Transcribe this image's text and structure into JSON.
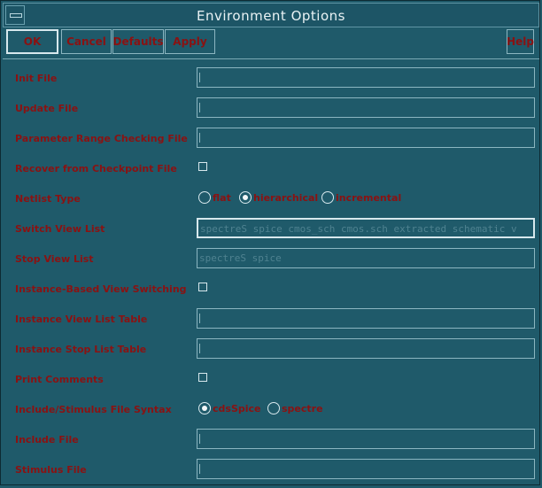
{
  "window": {
    "title": "Environment Options"
  },
  "toolbar": {
    "ok": "OK",
    "cancel": "Cancel",
    "defaults": "Defaults",
    "apply": "Apply",
    "help": "Help"
  },
  "form": {
    "init_file": {
      "label": "Init File",
      "value": ""
    },
    "update_file": {
      "label": "Update File",
      "value": ""
    },
    "parameter_range_checking_file": {
      "label": "Parameter Range Checking File",
      "value": ""
    },
    "recover_from_checkpoint_file": {
      "label": "Recover from Checkpoint File",
      "checked": false
    },
    "netlist_type": {
      "label": "Netlist Type",
      "options": [
        "flat",
        "hierarchical",
        "incremental"
      ],
      "selected": "hierarchical"
    },
    "switch_view_list": {
      "label": "Switch View List",
      "value": "spectreS spice cmos_sch cmos.sch extracted schematic v"
    },
    "stop_view_list": {
      "label": "Stop View List",
      "value": "spectreS spice"
    },
    "instance_based_view_switching": {
      "label": "Instance-Based View Switching",
      "checked": false
    },
    "instance_view_list_table": {
      "label": "Instance View List Table",
      "value": ""
    },
    "instance_stop_list_table": {
      "label": "Instance Stop List Table",
      "value": ""
    },
    "print_comments": {
      "label": "Print Comments",
      "checked": false
    },
    "include_stimulus_file_syntax": {
      "label": "Include/Stimulus File Syntax",
      "options": [
        "cdsSpice",
        "spectre"
      ],
      "selected": "cdsSpice"
    },
    "include_file": {
      "label": "Include File",
      "value": ""
    },
    "stimulus_file": {
      "label": "Stimulus File",
      "value": ""
    }
  }
}
